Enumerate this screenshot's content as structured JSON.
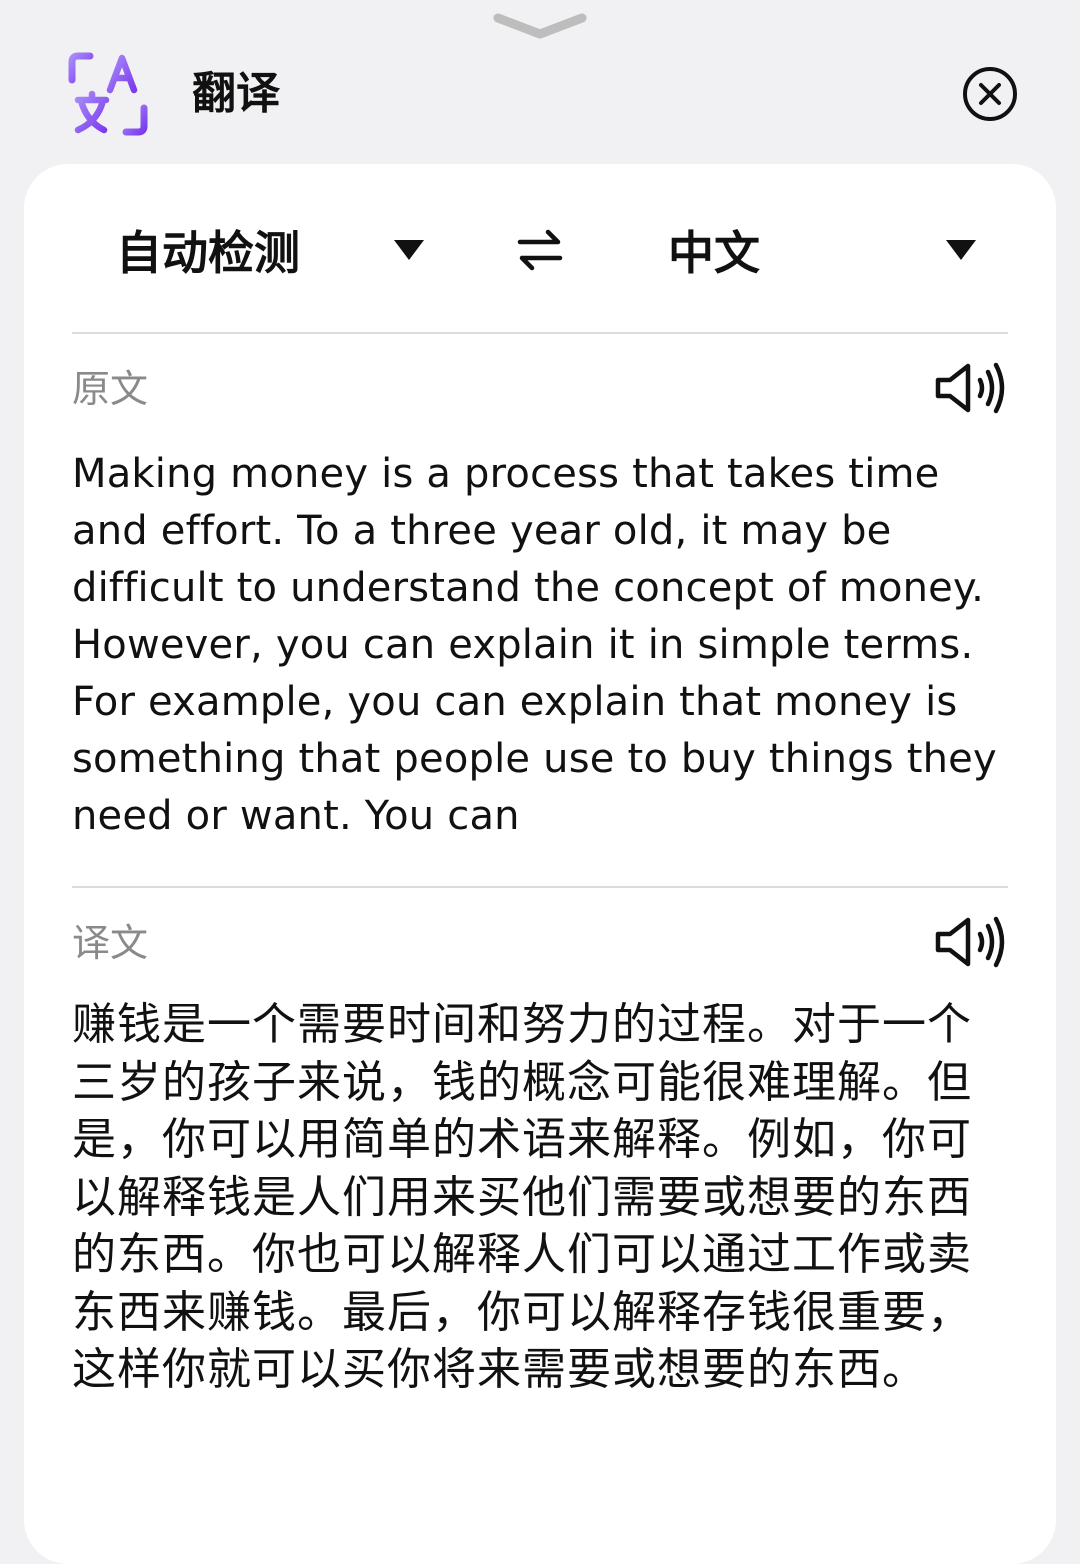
{
  "header": {
    "title": "翻译",
    "logo_icon": "translate-app-icon",
    "close_icon": "close-circle-icon",
    "accent_color": "#8b5cf6"
  },
  "languages": {
    "source": "自动检测",
    "target": "中文",
    "swap_icon": "swap-arrows-icon"
  },
  "source": {
    "label": "原文",
    "speaker_icon": "speaker-icon",
    "text": "Making money is a process that takes time and effort. To a three year old, it may be difficult to understand the concept of money. However, you can explain it in simple terms. For example, you can explain that money is something that people use to buy things they need or want. You can"
  },
  "translation": {
    "label": "译文",
    "speaker_icon": "speaker-icon",
    "text": "赚钱是一个需要时间和努力的过程。对于一个三岁的孩子来说，钱的概念可能很难理解。但是，你可以用简单的术语来解释。例如，你可以解释钱是人们用来买他们需要或想要的东西的东西。你也可以解释人们可以通过工作或卖东西来赚钱。最后，你可以解释存钱很重要，这样你就可以买你将来需要或想要的东西。"
  }
}
